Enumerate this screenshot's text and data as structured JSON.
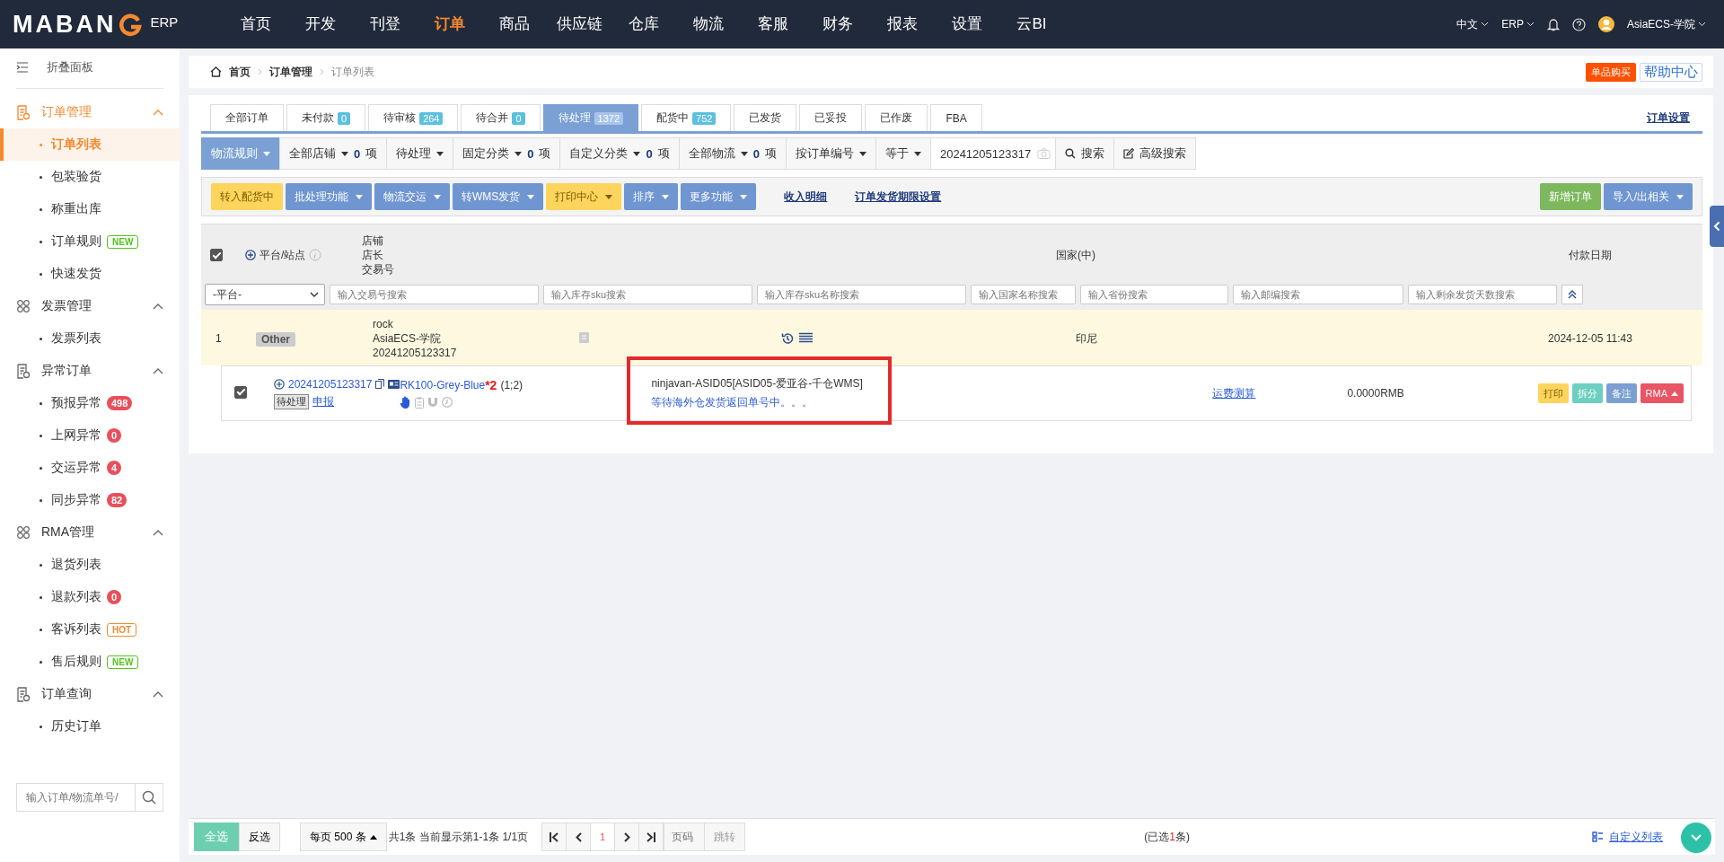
{
  "logo": {
    "brand": "MABAN",
    "suffix": "ERP"
  },
  "nav": [
    {
      "label": "首页",
      "selected": false
    },
    {
      "label": "开发",
      "selected": false
    },
    {
      "label": "刊登",
      "selected": false
    },
    {
      "label": "订单",
      "selected": true
    },
    {
      "label": "商品",
      "selected": false
    },
    {
      "label": "供应链",
      "selected": false
    },
    {
      "label": "仓库",
      "selected": false
    },
    {
      "label": "物流",
      "selected": false
    },
    {
      "label": "客服",
      "selected": false
    },
    {
      "label": "财务",
      "selected": false
    },
    {
      "label": "报表",
      "selected": false
    },
    {
      "label": "设置",
      "selected": false
    },
    {
      "label": "云BI",
      "selected": false
    }
  ],
  "top_right": {
    "language": "中文",
    "system": "ERP",
    "user": "AsiaECS-学院"
  },
  "sidebar": {
    "collapse": "折叠面板",
    "groups": [
      {
        "title": "订单管理",
        "kind": "document",
        "expanded": true,
        "selected": true,
        "items": [
          {
            "label": "订单列表",
            "selected": true
          },
          {
            "label": "包装验货",
            "selected": false
          },
          {
            "label": "称重出库",
            "selected": false
          },
          {
            "label": "订单规则",
            "selected": false,
            "badge": {
              "text": "NEW",
              "kind": "new"
            }
          },
          {
            "label": "快速发货",
            "selected": false
          }
        ]
      },
      {
        "title": "发票管理",
        "kind": "circles",
        "expanded": true,
        "selected": false,
        "items": [
          {
            "label": "发票列表",
            "selected": false
          }
        ]
      },
      {
        "title": "异常订单",
        "kind": "document",
        "expanded": true,
        "selected": false,
        "items": [
          {
            "label": "预报异常",
            "selected": false,
            "badge": {
              "text": "498",
              "kind": "count"
            }
          },
          {
            "label": "上网异常",
            "selected": false,
            "badge": {
              "text": "0",
              "kind": "count"
            }
          },
          {
            "label": "交运异常",
            "selected": false,
            "badge": {
              "text": "4",
              "kind": "count"
            }
          },
          {
            "label": "同步异常",
            "selected": false,
            "badge": {
              "text": "82",
              "kind": "count"
            }
          }
        ]
      },
      {
        "title": "RMA管理",
        "kind": "circles",
        "expanded": true,
        "selected": false,
        "items": [
          {
            "label": "退货列表",
            "selected": false
          },
          {
            "label": "退款列表",
            "selected": false,
            "badge": {
              "text": "0",
              "kind": "count"
            }
          },
          {
            "label": "客诉列表",
            "selected": false,
            "badge": {
              "text": "HOT",
              "kind": "hot"
            }
          },
          {
            "label": "售后规则",
            "selected": false,
            "badge": {
              "text": "NEW",
              "kind": "new"
            }
          }
        ]
      },
      {
        "title": "订单查询",
        "kind": "document",
        "expanded": true,
        "selected": false,
        "items": [
          {
            "label": "历史订单",
            "selected": false
          }
        ]
      }
    ],
    "search": {
      "placeholder": "输入订单/物流单号/"
    }
  },
  "breadcrumb": [
    "首页",
    "订单管理",
    "订单列表"
  ],
  "header_buttons": [
    {
      "label": "单品购买",
      "kind": "solid"
    },
    {
      "label": "帮助中心",
      "kind": "outline"
    }
  ],
  "tabs": [
    {
      "label": "全部订单",
      "selected": false
    },
    {
      "label": "未付款",
      "count": "0",
      "selected": false
    },
    {
      "label": "待审核",
      "count": "264",
      "selected": false
    },
    {
      "label": "待合并",
      "count": "0",
      "selected": false
    },
    {
      "label": "待处理",
      "count": "1372",
      "selected": true
    },
    {
      "label": "配货中",
      "count": "752",
      "selected": false
    },
    {
      "label": "已发货",
      "selected": false
    },
    {
      "label": "已妥投",
      "selected": false
    },
    {
      "label": "已作废",
      "selected": false
    },
    {
      "label": "FBA",
      "selected": false
    }
  ],
  "tab_settings": "订单设置",
  "filters": [
    {
      "kind": "primary",
      "label": "物流规则"
    },
    {
      "kind": "select",
      "label": "全部店铺",
      "count": "0",
      "unit": "项"
    },
    {
      "kind": "select",
      "label": "待处理"
    },
    {
      "kind": "select",
      "label": "固定分类",
      "count": "0",
      "unit": "项"
    },
    {
      "kind": "select",
      "label": "自定义分类",
      "count": "0",
      "unit": "项"
    },
    {
      "kind": "select",
      "label": "全部物流",
      "count": "0",
      "unit": "项"
    },
    {
      "kind": "select",
      "label": "按订单编号"
    },
    {
      "kind": "select",
      "label": "等于"
    }
  ],
  "search": {
    "value": "20241205123317",
    "button": "搜索",
    "advanced": "高级搜索"
  },
  "actions": [
    {
      "kind": "warning",
      "label": "转入配货中",
      "dropdown": false
    },
    {
      "kind": "primary",
      "label": "批处理功能",
      "dropdown": true
    },
    {
      "kind": "primary",
      "label": "物流交运",
      "dropdown": true
    },
    {
      "kind": "primary",
      "label": "转WMS发货",
      "dropdown": true
    },
    {
      "kind": "warning",
      "label": "打印中心",
      "dropdown": true
    },
    {
      "kind": "primary",
      "label": "排序",
      "dropdown": true
    },
    {
      "kind": "primary",
      "label": "更多功能",
      "dropdown": true
    },
    {
      "kind": "link",
      "label": "收入明细",
      "dropdown": false
    },
    {
      "kind": "link",
      "label": "订单发货期限设置",
      "dropdown": false
    }
  ],
  "right_actions": [
    {
      "kind": "success",
      "label": "新增订单",
      "dropdown": false
    },
    {
      "kind": "primary",
      "label": "导入/出相关",
      "dropdown": true
    }
  ],
  "table": {
    "all_checked": true,
    "columns": {
      "platform": "平台/站点",
      "shop": [
        "店铺",
        "店长",
        "交易号"
      ],
      "country": "国家(中)",
      "paid": "付款日期"
    },
    "platform_select": "-平台-",
    "filter_placeholders": [
      "输入交易号搜索",
      "输入库存sku搜索",
      "输入库存sku名称搜索",
      "输入国家名称搜索",
      "输入省份搜索",
      "输入邮编搜索",
      "输入剩余发货天数搜索"
    ],
    "orders": [
      {
        "index": "1",
        "platform": "Other",
        "shop": "rock",
        "manager": "AsiaECS-学院",
        "transaction": "20241205123317",
        "country": "印尼",
        "paid": "2024-12-05 11:43",
        "items": [
          {
            "checked": true,
            "order_no": "20241205123317",
            "status": "待处理",
            "declare": "申报",
            "sku": "RK100-Grey-Blue",
            "qty": "*2",
            "qty_detail": "(1;2)",
            "shipping": "ninjavan-ASID05[ASID05-爱亚谷-千仓WMS]",
            "shipping_status": "等待海外仓发货返回单号中。。。",
            "highlighted": true,
            "freight": "运费测算",
            "amount": "0.0000RMB",
            "buttons": [
              {
                "label": "打印",
                "color": "#fdd55c",
                "dropdown": false
              },
              {
                "label": "拆分",
                "color": "#6dcfc0",
                "dropdown": false
              },
              {
                "label": "备注",
                "color": "#7b9fd1",
                "dropdown": false
              },
              {
                "label": "RMA",
                "color": "#ea5565",
                "dropdown": true
              }
            ]
          }
        ]
      }
    ]
  },
  "footer": {
    "select_all": "全选",
    "invert": "反选",
    "page_size": {
      "prefix": "每页",
      "value": "500",
      "unit": "条"
    },
    "summary": "共1条 当前显示第1-1条 1/1页",
    "current_page": "1",
    "page_placeholder": "页码",
    "go": "跳转",
    "selected": "(已选**1**条)",
    "custom_columns": "自定义列表"
  }
}
